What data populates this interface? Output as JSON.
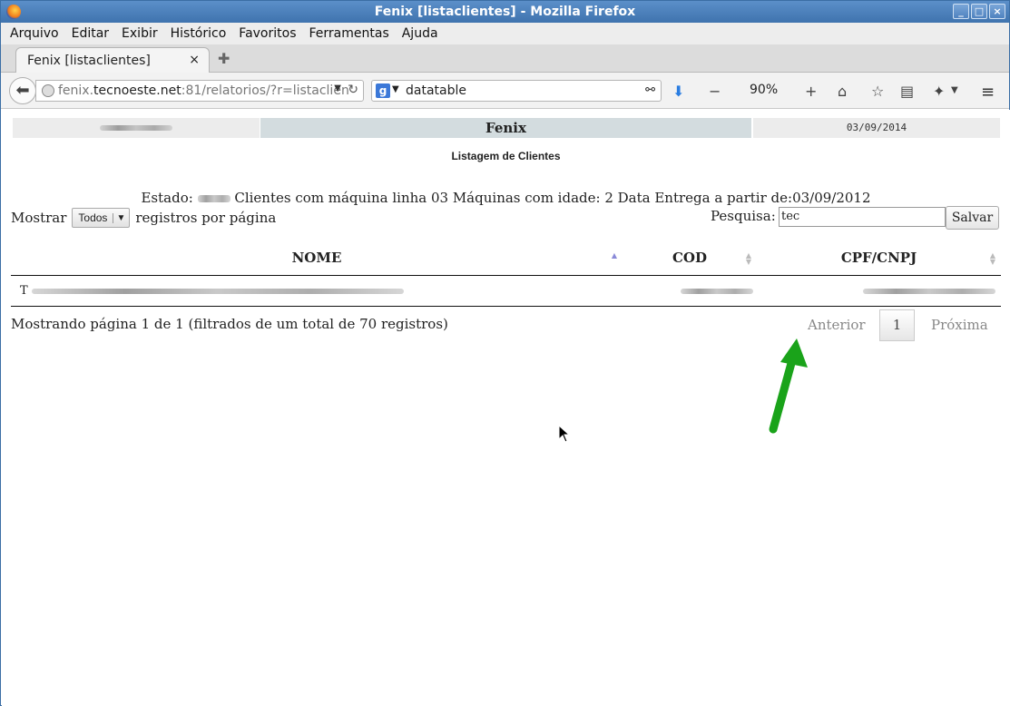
{
  "window": {
    "title": "Fenix [listaclientes] - Mozilla Firefox"
  },
  "menu": [
    "Arquivo",
    "Editar",
    "Exibir",
    "Histórico",
    "Favoritos",
    "Ferramentas",
    "Ajuda"
  ],
  "tab": {
    "label": "Fenix [listaclientes]",
    "close": "×"
  },
  "address": {
    "host_pre": "fenix.",
    "host": "tecnoeste.net",
    "rest": ":81/relatorios/?r=listaclien"
  },
  "search": {
    "value": "datatable",
    "engine_label": "g"
  },
  "toolbar": {
    "zoom": "90%",
    "zoom_out": "−",
    "zoom_in": "+"
  },
  "page": {
    "header_center": "Fenix",
    "header_date": "03/09/2014",
    "subtitle": "Listagem de Clientes",
    "estado_prefix": "Estado:",
    "estado_rest": "Clientes com máquina linha 03 Máquinas com idade: 2 Data Entrega a partir de:03/09/2012",
    "show_label": "Mostrar",
    "show_select": "Todos",
    "show_suffix": "registros por página",
    "search_label": "Pesquisa:",
    "search_value": "tec",
    "save_label": "Salvar",
    "columns": [
      "NOME",
      "COD",
      "CPF/CNPJ"
    ],
    "row_first_char": "T",
    "info": "Mostrando página 1 de 1 (filtrados de um total de 70 registros)",
    "prev": "Anterior",
    "page_num": "1",
    "next": "Próxima"
  },
  "colors": {
    "accent_arrow": "#1aa31a",
    "header_center_bg": "#d3dcdf",
    "titlebar": "#4a7fbb"
  }
}
